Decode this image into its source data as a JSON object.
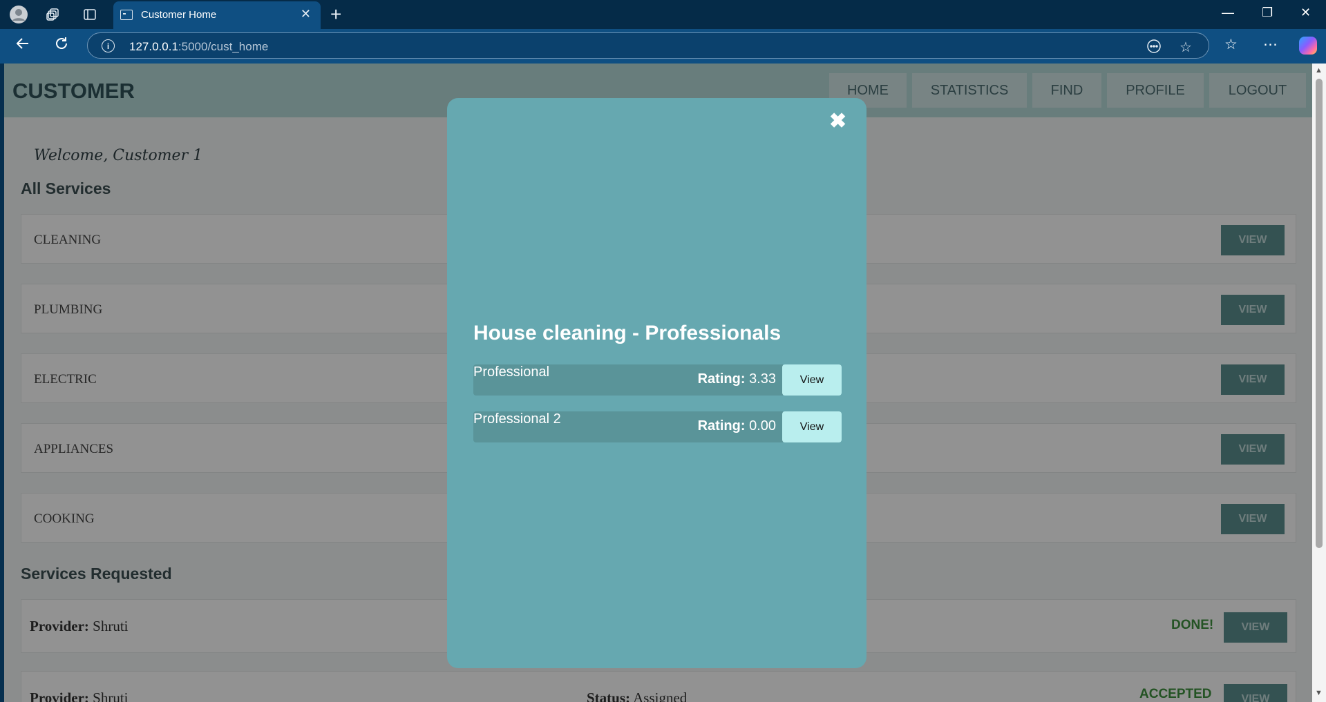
{
  "browser": {
    "tab_title": "Customer Home",
    "url_host": "127.0.0.1",
    "url_path": ":5000/cust_home"
  },
  "header": {
    "brand": "CUSTOMER",
    "nav": [
      "HOME",
      "STATISTICS",
      "FIND",
      "PROFILE",
      "LOGOUT"
    ]
  },
  "welcome": "Welcome, Customer 1",
  "all_services": {
    "title": "All Services",
    "view_label": "VIEW",
    "items": [
      "CLEANING",
      "PLUMBING",
      "ELECTRIC",
      "APPLIANCES",
      "COOKING"
    ]
  },
  "requested": {
    "title": "Services Requested",
    "provider_label": "Provider:",
    "status_label": "Status:",
    "view_label": "VIEW",
    "rows": [
      {
        "provider": "Shruti",
        "badge": "DONE!",
        "status": ""
      },
      {
        "provider": "Shruti",
        "badge": "ACCEPTED",
        "status": "Assigned"
      }
    ]
  },
  "modal": {
    "close_glyph": "✖",
    "title": "House cleaning - Professionals",
    "rating_label": "Rating:",
    "view_label": "View",
    "professionals": [
      {
        "name": "Professional",
        "rating": "3.33"
      },
      {
        "name": "Professional 2",
        "rating": "0.00"
      }
    ]
  },
  "colors": {
    "modal_bg": "#66a8b0",
    "view_button": "#b9eeee",
    "header_bg": "#b3d8d6"
  }
}
